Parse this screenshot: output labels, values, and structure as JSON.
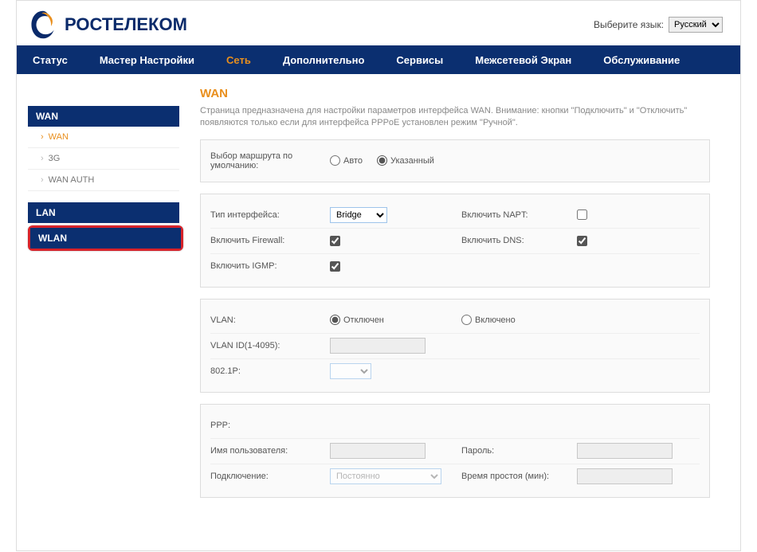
{
  "lang": {
    "label": "Выберите язык:",
    "selected": "Русский",
    "options": [
      "Русский"
    ]
  },
  "brand": "РОСТЕЛЕКОМ",
  "nav": {
    "status": "Статус",
    "wizard": "Мастер Настройки",
    "network": "Сеть",
    "advanced": "Дополнительно",
    "services": "Сервисы",
    "firewall": "Межсетевой Экран",
    "maint": "Обслуживание"
  },
  "sidebar": {
    "wan": "WAN",
    "wan_items": {
      "wan": "WAN",
      "g3": "3G",
      "auth": "WAN AUTH"
    },
    "lan": "LAN",
    "wlan": "WLAN"
  },
  "page": {
    "title": "WAN",
    "desc": "Страница предназначена для настройки параметров интерфейса WAN. Внимание: кнопки \"Подключить\" и \"Отключить\" появляются только если для интерфейса PPPoE установлен режим \"Ручной\"."
  },
  "panel1": {
    "route_label": "Выбор маршрута по умолчанию:",
    "opt_auto": "Авто",
    "opt_spec": "Указанный",
    "selected": "spec"
  },
  "panel2": {
    "iface_type": "Тип интерфейса:",
    "iface_sel": "Bridge",
    "napt": "Включить NAPT:",
    "firewall": "Включить Firewall:",
    "dns": "Включить DNS:",
    "igmp": "Включить IGMP:"
  },
  "panel3": {
    "vlan": "VLAN:",
    "opt_off": "Отключен",
    "opt_on": "Включено",
    "vlan_id": "VLAN ID(1-4095):",
    "p8021": "802.1P:"
  },
  "panel4": {
    "ppp": "PPP:",
    "user": "Имя пользователя:",
    "pass": "Пароль:",
    "conn": "Подключение:",
    "conn_sel": "Постоянно",
    "idle": "Время простоя (мин):"
  }
}
